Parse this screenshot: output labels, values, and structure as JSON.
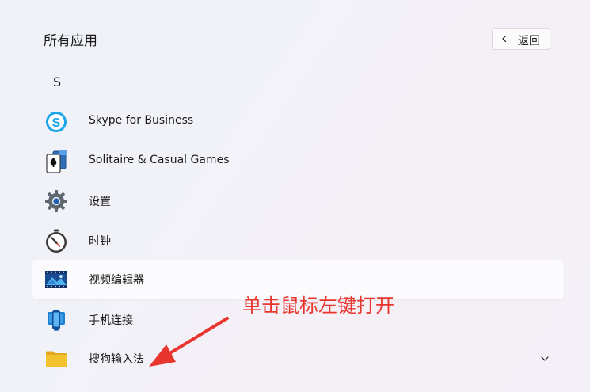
{
  "header": {
    "title": "所有应用",
    "back_label": "返回"
  },
  "section": {
    "letter": "S"
  },
  "apps": [
    {
      "label": "Skype for Business",
      "icon": "skype-icon"
    },
    {
      "label": "Solitaire & Casual Games",
      "icon": "solitaire-icon"
    },
    {
      "label": "设置",
      "icon": "settings-gear-icon"
    },
    {
      "label": "时钟",
      "icon": "clock-icon"
    },
    {
      "label": "视频编辑器",
      "icon": "video-editor-icon"
    },
    {
      "label": "手机连接",
      "icon": "phone-link-icon"
    },
    {
      "label": "搜狗输入法",
      "icon": "folder-icon"
    }
  ],
  "annotation": {
    "text": "单击鼠标左键打开",
    "color": "#e8352d"
  },
  "colors": {
    "skype_blue": "#1aa3e8",
    "folder_yellow": "#f2c12e",
    "annotation_red": "#e8352d"
  }
}
